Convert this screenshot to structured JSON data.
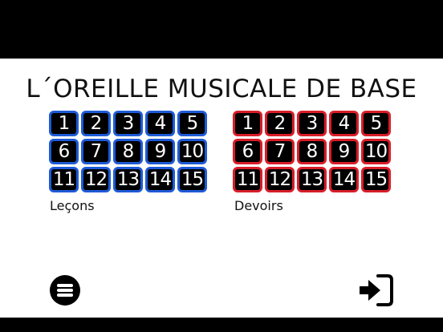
{
  "title": "L´OREILLE MUSICALE DE BASE",
  "lessons": {
    "label": "Leçons",
    "accent": "#1e5bd6",
    "numbers": [
      "1",
      "2",
      "3",
      "4",
      "5",
      "6",
      "7",
      "8",
      "9",
      "10",
      "11",
      "12",
      "13",
      "14",
      "15"
    ]
  },
  "homework": {
    "label": "Devoirs",
    "accent": "#d81e2a",
    "numbers": [
      "1",
      "2",
      "3",
      "4",
      "5",
      "6",
      "7",
      "8",
      "9",
      "10",
      "11",
      "12",
      "13",
      "14",
      "15"
    ]
  },
  "footer": {
    "menu_icon": "menu-icon",
    "enter_icon": "sign-in-icon"
  }
}
